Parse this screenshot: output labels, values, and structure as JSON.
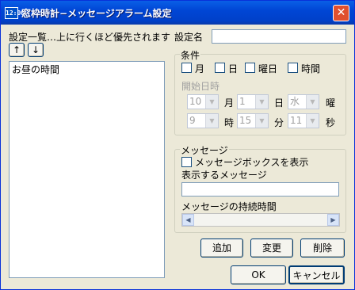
{
  "window": {
    "title": "窓枠時計−メッセージアラーム設定",
    "icon_text": "12:00",
    "close_glyph": "✕"
  },
  "settings_list": {
    "header": "設定一覧…上に行くほど優先されます",
    "up_label": "↑",
    "down_label": "↓",
    "items": [
      "お昼の時間"
    ]
  },
  "setting_name": {
    "label": "設定名",
    "value": ""
  },
  "conditions": {
    "title": "条件",
    "month_label": "月",
    "day_label": "日",
    "weekday_label": "曜日",
    "time_label": "時間",
    "start_label": "開始日時",
    "month_value": "10",
    "month_unit": "月",
    "day_value": "1",
    "day_unit": "日",
    "weekday_value": "水",
    "weekday_unit": "曜",
    "hour_value": "9",
    "hour_unit": "時",
    "minute_value": "15",
    "minute_unit": "分",
    "second_value": "11",
    "second_unit": "秒"
  },
  "message": {
    "title": "メッセージ",
    "show_box_label": "メッセージボックスを表示",
    "text_label": "表示するメッセージ",
    "text_value": "",
    "duration_label": "メッセージの持続時間",
    "duration_level": 0
  },
  "buttons": {
    "add": "追加",
    "change": "変更",
    "delete": "削除",
    "ok": "OK",
    "cancel": "キャンセル"
  }
}
